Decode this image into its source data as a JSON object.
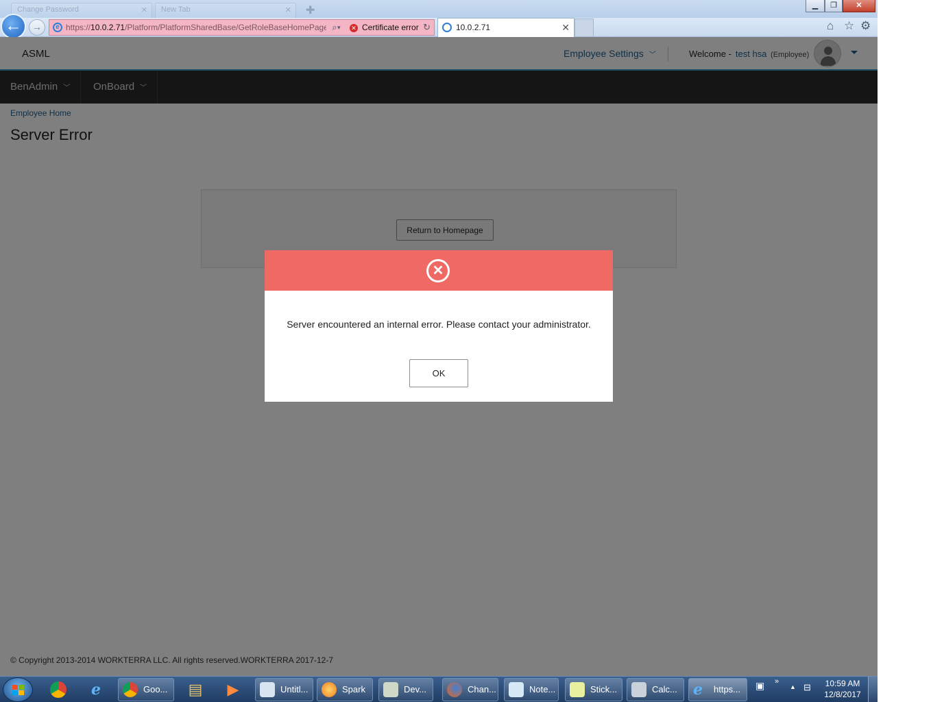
{
  "browser": {
    "background_tabs": [
      "Change Password",
      "New Tab"
    ],
    "address": {
      "scheme": "https://",
      "host": "10.0.2.71",
      "path": "/Platform/PlatformSharedBase/GetRoleBaseHomePage"
    },
    "certificate_error": "Certificate error",
    "active_tab_title": "10.0.2.71"
  },
  "header": {
    "brand": "ASML",
    "employee_settings": "Employee Settings",
    "welcome_label": "Welcome -",
    "user_name": "test hsa",
    "user_role": "(Employee)"
  },
  "menu": {
    "items": [
      "BenAdmin",
      "OnBoard"
    ]
  },
  "page": {
    "breadcrumb": "Employee Home",
    "title": "Server Error",
    "return_button": "Return to Homepage",
    "footer": "© Copyright 2013-2014 WORKTERRA LLC. All rights reserved.WORKTERRA 2017-12-7"
  },
  "modal": {
    "message": "Server encountered an internal error. Please contact your administrator.",
    "ok_label": "OK",
    "header_color": "#f06a65"
  },
  "taskbar": {
    "items": [
      "Goo...",
      "Untitl...",
      "Spark",
      "Dev...",
      "Chan...",
      "Note...",
      "Stick...",
      "Calc...",
      "https..."
    ],
    "time": "10:59 AM",
    "date": "12/8/2017"
  }
}
